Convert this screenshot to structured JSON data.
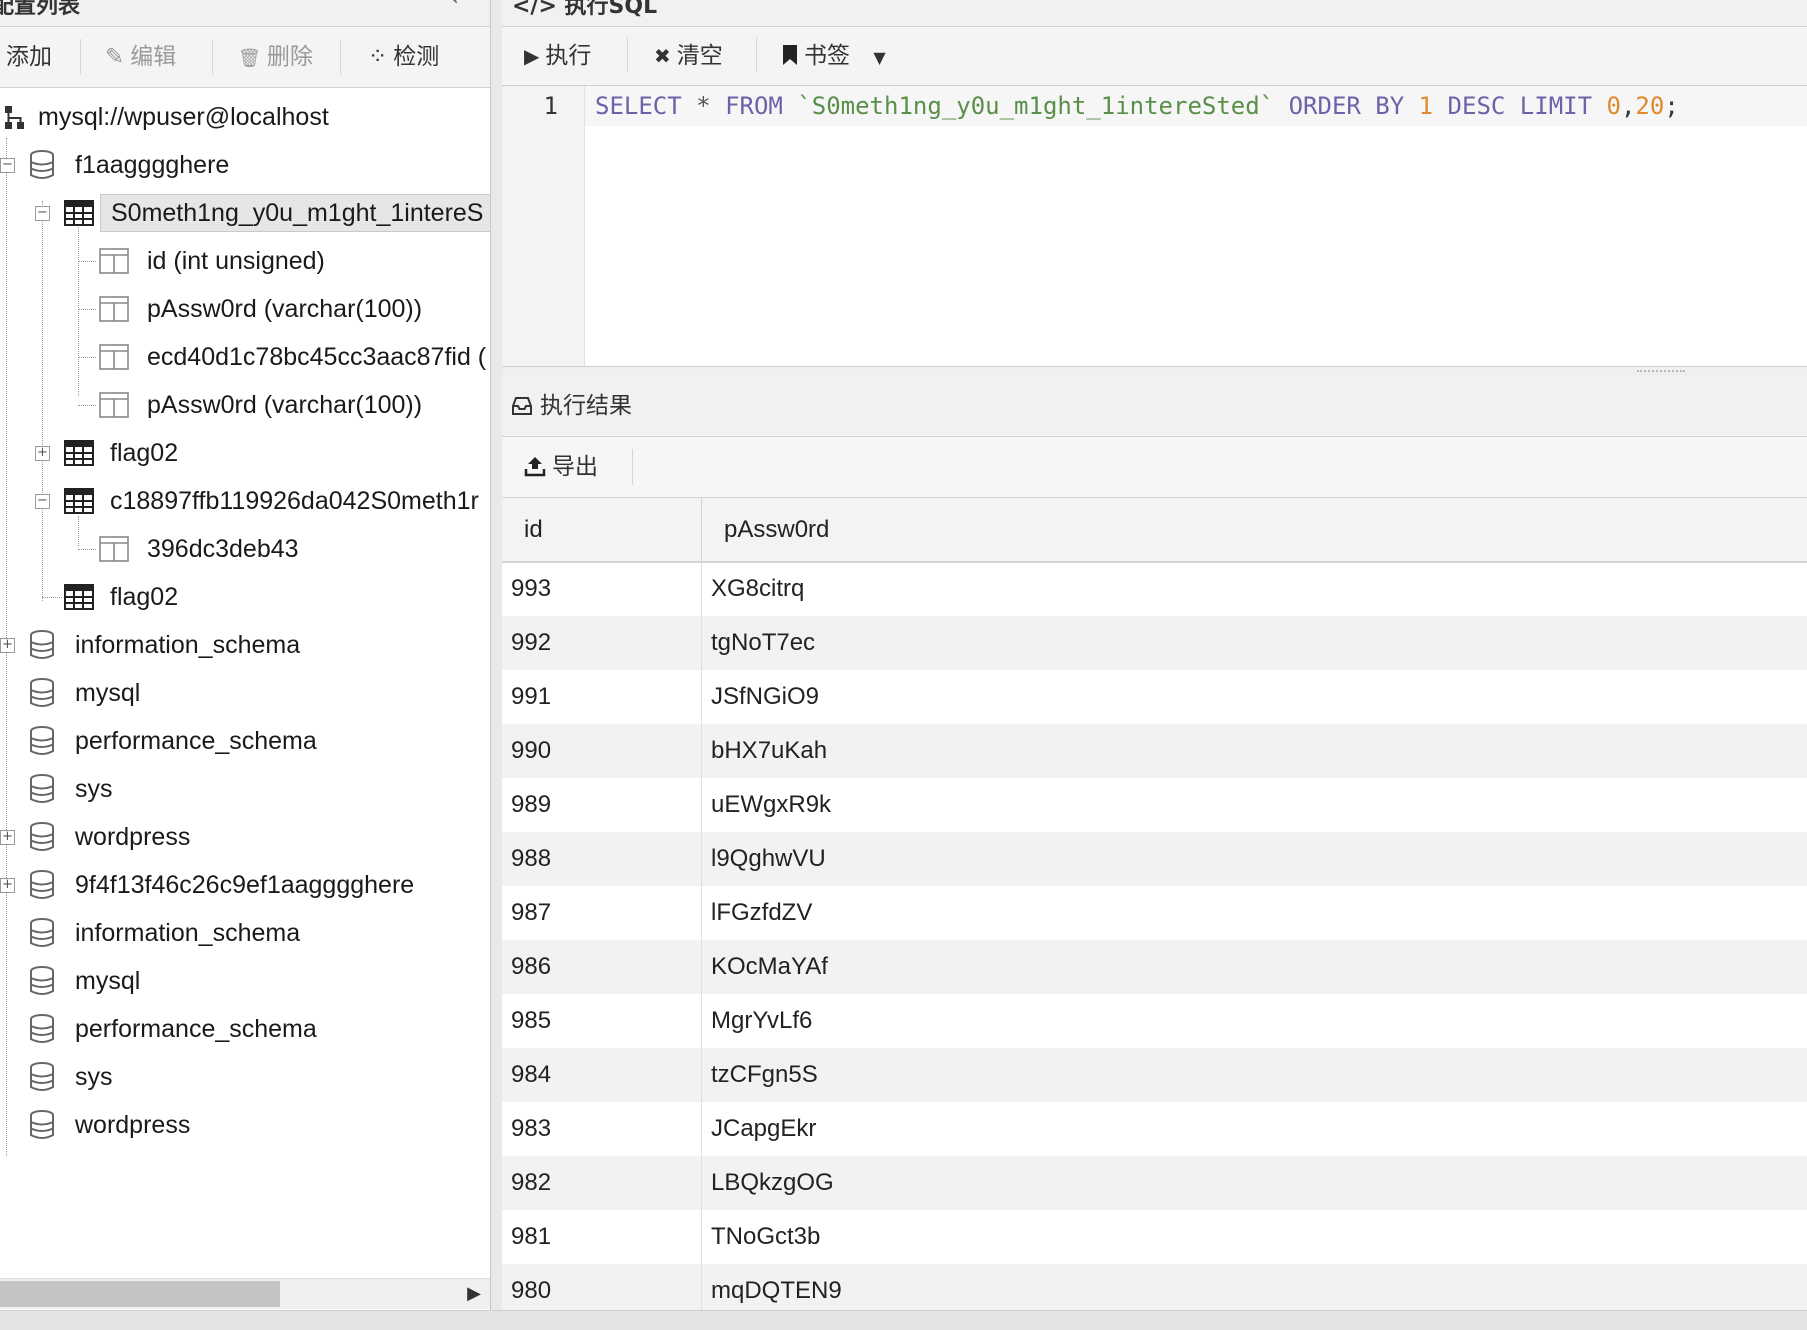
{
  "left_panel": {
    "title": "配置列表",
    "collapse_icon": "‹",
    "toolbar": {
      "add": "添加",
      "edit": "编辑",
      "delete": "删除",
      "detect": "检测"
    },
    "tree": {
      "connection": "mysql://wpuser@localhost",
      "db1": "f1aagggghere",
      "tbl_selected": "S0meth1ng_y0u_m1ght_1intereS",
      "col_id": "id (int unsigned)",
      "col_pw1": "pAssw0rd (varchar(100))",
      "col_fid": "ecd40d1c78bc45cc3aac87fid (",
      "col_pw2": "pAssw0rd (varchar(100))",
      "tbl_flag02": "flag02",
      "tbl_c18": "c18897ffb119926da042S0meth1r",
      "col_396": "396dc3deb43",
      "tbl_flag02b": "flag02",
      "db_info1": "information_schema",
      "db_mysql1": "mysql",
      "db_perf1": "performance_schema",
      "db_sys1": "sys",
      "db_wp1": "wordpress",
      "db_9f4": "9f4f13f46c26c9ef1aagggghere",
      "db_info2": "information_schema",
      "db_mysql2": "mysql",
      "db_perf2": "performance_schema",
      "db_sys2": "sys",
      "db_wp2": "wordpress"
    }
  },
  "sql_panel": {
    "title": "</> 执行SQL",
    "toolbar": {
      "execute": "执行",
      "clear": "清空",
      "bookmark": "书签"
    },
    "editor": {
      "line_number": "1",
      "t_select": "SELECT",
      "t_star": " * ",
      "t_from": "FROM",
      "t_table": " `S0meth1ng_y0u_m1ght_1intereSted` ",
      "t_order": "ORDER BY",
      "t_one": " 1 ",
      "t_desc": "DESC",
      "t_sp": " ",
      "t_limit": "LIMIT",
      "t_zero": " 0",
      "t_comma": ",",
      "t_twenty": "20",
      "t_semi": ";"
    }
  },
  "result_panel": {
    "title": "执行结果",
    "toolbar": {
      "export": "导出"
    },
    "columns": [
      "id",
      "pAssw0rd"
    ],
    "rows": [
      [
        "993",
        "XG8citrq"
      ],
      [
        "992",
        "tgNoT7ec"
      ],
      [
        "991",
        "JSfNGiO9"
      ],
      [
        "990",
        "bHX7uKah"
      ],
      [
        "989",
        "uEWgxR9k"
      ],
      [
        "988",
        "l9QghwVU"
      ],
      [
        "987",
        "lFGzfdZV"
      ],
      [
        "986",
        "KOcMaYAf"
      ],
      [
        "985",
        "MgrYvLf6"
      ],
      [
        "984",
        "tzCFgn5S"
      ],
      [
        "983",
        "JCapgEkr"
      ],
      [
        "982",
        "LBQkzgOG"
      ],
      [
        "981",
        "TNoGct3b"
      ],
      [
        "980",
        "mqDQTEN9"
      ]
    ]
  },
  "icons": {
    "play": "▶",
    "close": "✖",
    "bookmark": "🔖",
    "caret": "▼",
    "edit": "✎",
    "trash": "🗑",
    "spinner": "⁘",
    "export": "⇧",
    "inbox": "⌂",
    "scroll_right": "▶"
  },
  "colors": {
    "keyword": "#6e61a8",
    "backtick_string": "#5a8f4a",
    "number": "#e08a2e"
  }
}
